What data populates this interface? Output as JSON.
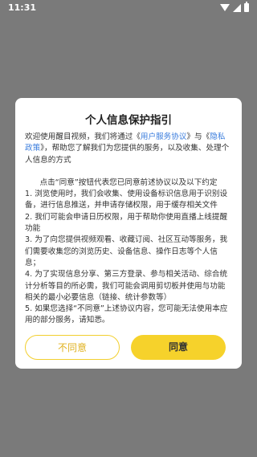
{
  "status_bar": {
    "time": "11:31"
  },
  "dialog": {
    "title": "个人信息保护指引",
    "intro": {
      "part1": "欢迎使用醒目视频，我们将通过《",
      "link1": "用户服务协议",
      "part2": "》与《",
      "link2": "隐私政策",
      "part3": "》，帮助您了解我们为您提供的服务，以及收集、处理个人信息的方式"
    },
    "paragraph_intro": "点击“同意”按钮代表您已同意前述协议以及以下约定",
    "items": [
      "1. 浏览使用时，我们会收集、使用设备标识信息用于识别设备，进行信息推送，并申请存储权限，用于缓存相关文件",
      "2. 我们可能会申请日历权限，用于帮助你使用直播上线提醒功能",
      "3. 为了向您提供视频观看、收藏订阅、社区互动等服务，我们需要收集您的浏览历史、设备信息、操作日志等个人信息；",
      "4. 为了实现信息分享、第三方登录、参与相关活动、综合统计分析等目的所必需，我们可能会调用剪切板并使用与功能相关的最小必要信息（链接、统计参数等）",
      "5. 如果您选择“不同意”上述协议内容，您可能无法使用本应用的部分服务，请知悉。"
    ],
    "disagree_label": "不同意",
    "agree_label": "同意"
  }
}
